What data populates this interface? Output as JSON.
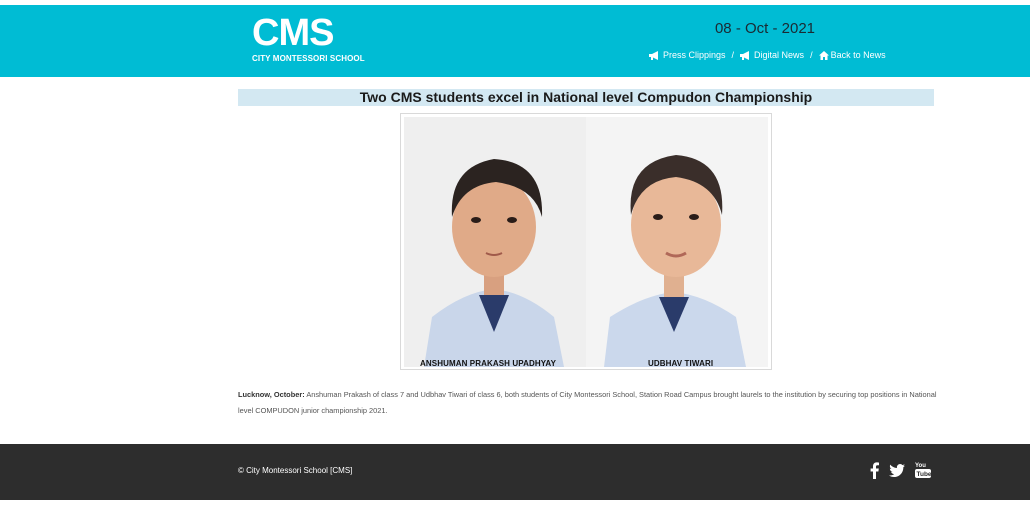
{
  "header": {
    "logo_text": "CMS",
    "logo_subtitle": "CITY MONTESSORI SCHOOL",
    "date": "08 - Oct - 2021",
    "nav": {
      "press_clippings": "Press Clippings",
      "digital_news": "Digital News",
      "back_to_news": "Back to News",
      "separator": "/"
    },
    "bg_color": "#00bcd4"
  },
  "article": {
    "title": "Two CMS students excel in National level Compudon Championship",
    "photo_captions": [
      "ANSHUMAN PRAKASH UPADHYAY",
      "UDBHAV TIWARI"
    ],
    "dateline": "Lucknow, October:",
    "body": "Anshuman Prakash of class 7 and Udbhav Tiwari of class 6, both students of City Montessori School, Station Road Campus brought laurels to the institution by securing top positions in National level COMPUDON junior championship 2021."
  },
  "footer": {
    "copyright": "© City Montessori School [CMS]",
    "social_icons": [
      "facebook-icon",
      "twitter-icon",
      "youtube-icon"
    ],
    "bg_color": "#2d2d2d"
  }
}
